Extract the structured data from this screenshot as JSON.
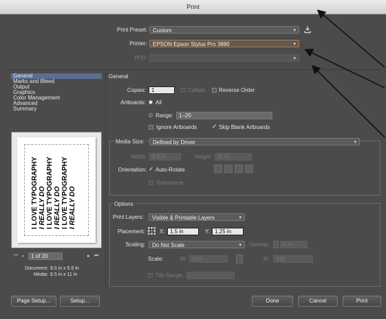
{
  "window": {
    "title": "Print"
  },
  "top": {
    "preset_label": "Print Preset:",
    "preset_value": "Custom",
    "printer_label": "Printer:",
    "printer_value": "EPSON Epson Stylus Pro 3880",
    "ppd_label": "PPD:"
  },
  "sidebar": {
    "items": [
      "General",
      "Marks and Bleed",
      "Output",
      "Graphics",
      "Color Management",
      "Advanced",
      "Summary"
    ]
  },
  "preview": {
    "lines": [
      "I LOVE TYPOGRAPHY",
      "I REALLY DO",
      "I LOVE TYPOGRAPHY",
      "I REALLY DO",
      "I LOVE TYPOGRAPHY",
      "I REALLY DO"
    ],
    "page_indicator": "1 of 20",
    "document_label": "Document:",
    "document_value": "8.5 in x 5.5 in",
    "media_label": "Media:",
    "media_value": "8.5 in x 11 in"
  },
  "general": {
    "section_title": "General",
    "copies_label": "Copies:",
    "copies_value": "1",
    "collate_label": "Collate",
    "reverse_label": "Reverse Order",
    "artboards_label": "Artboards:",
    "all_label": "All",
    "range_label": "Range:",
    "range_value": "1–20",
    "ignore_label": "Ignore Artboards",
    "skip_label": "Skip Blank Artboards"
  },
  "media": {
    "size_label": "Media Size:",
    "size_value": "Defined by Driver",
    "width_label": "Width:",
    "width_value": "8.5 in",
    "height_label": "Height:",
    "height_value": "11 in",
    "orientation_label": "Orientation:",
    "autorotate_label": "Auto-Rotate",
    "transverse_label": "Transverse"
  },
  "options": {
    "section_title": "Options",
    "layers_label": "Print Layers:",
    "layers_value": "Visible & Printable Layers",
    "placement_label": "Placement:",
    "x_label": "X:",
    "x_value": "1.5 in",
    "y_label": "Y:",
    "y_value": "1.25 in",
    "scaling_label": "Scaling:",
    "scaling_value": "Do Not Scale",
    "overlap_label": "Overlap:",
    "overlap_value": "0 in",
    "scale_label": "Scale:",
    "w_label": "W:",
    "w_value": "100",
    "h_label": "H:",
    "h_value": "100",
    "tile_label": "Tile Range:"
  },
  "buttons": {
    "page_setup": "Page Setup...",
    "setup": "Setup...",
    "done": "Done",
    "cancel": "Cancel",
    "print": "Print"
  },
  "colors": {
    "dialog_bg": "#4b4b4b",
    "sidebar_selected": "#5d6e92",
    "printer_focus": "#c9772e"
  }
}
